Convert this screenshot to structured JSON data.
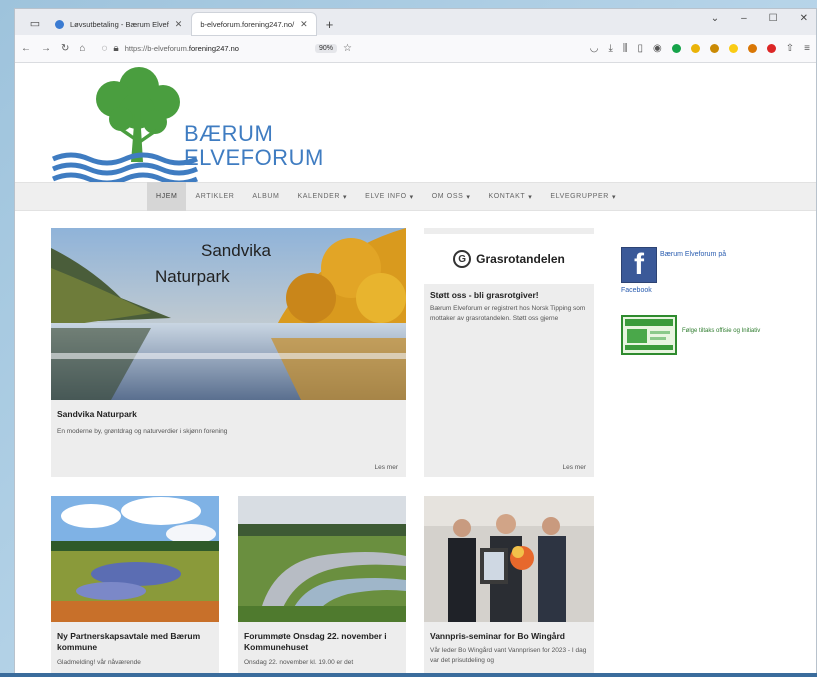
{
  "browser": {
    "tabs": [
      {
        "label": "Løvsutbetaling - Bærum Elvef",
        "close": "✕"
      },
      {
        "label": "b-elveforum.forening247.no/",
        "close": "✕"
      }
    ],
    "new_tab": "+",
    "url_prefix": "https://b-elveforum.",
    "url_domain": "forening247.no",
    "zoom": "90%"
  },
  "site": {
    "logo_line1": "BÆRUM",
    "logo_line2": "ELVEFORUM",
    "colors": {
      "brand_blue": "#3f7cc1",
      "brand_green": "#4a9e3f"
    }
  },
  "menu": [
    {
      "label": "HJEM",
      "active": true,
      "dropdown": false
    },
    {
      "label": "ARTIKLER",
      "active": false,
      "dropdown": false
    },
    {
      "label": "ALBUM",
      "active": false,
      "dropdown": false
    },
    {
      "label": "KALENDER",
      "active": false,
      "dropdown": true
    },
    {
      "label": "ELVE INFO",
      "active": false,
      "dropdown": true
    },
    {
      "label": "OM OSS",
      "active": false,
      "dropdown": true
    },
    {
      "label": "KONTAKT",
      "active": false,
      "dropdown": true
    },
    {
      "label": "ELVEGRUPPER",
      "active": false,
      "dropdown": true
    }
  ],
  "cards": {
    "featured": {
      "image_caption_1": "Sandvika",
      "image_caption_2": "Naturpark",
      "title": "Sandvika Naturpark",
      "text": "En moderne by, grøntdrag og naturverdier i skjønn forening",
      "readmore": "Les mer"
    },
    "grasrot": {
      "logo": "Grasrotandelen",
      "title": "Støtt oss - bli grasrotgiver!",
      "text": "Bærum Elveforum er registrert hos Norsk Tipping som mottaker av grasrotandelen. Støtt oss gjerne",
      "readmore": "Les mer"
    },
    "c1": {
      "title": "Ny Partnerskapsavtale med Bærum kommune",
      "text": "Gladmelding! vår nåværende"
    },
    "c2": {
      "title": "Forummøte Onsdag 22. november i Kommunehuset",
      "text": "Onsdag 22. november kl. 19.00 er det"
    },
    "c3": {
      "title": "Vannpris-seminar for Bo Wingård",
      "text": "Vår leder Bo Wingård vant Vannprisen for 2023 - I dag var det prisutdeling og"
    }
  },
  "sidebar": {
    "facebook_link": "Bærum Elveforum på",
    "facebook_link2": "Facebook",
    "green_link": "Følge tiltaks offisie og Initiativ"
  }
}
